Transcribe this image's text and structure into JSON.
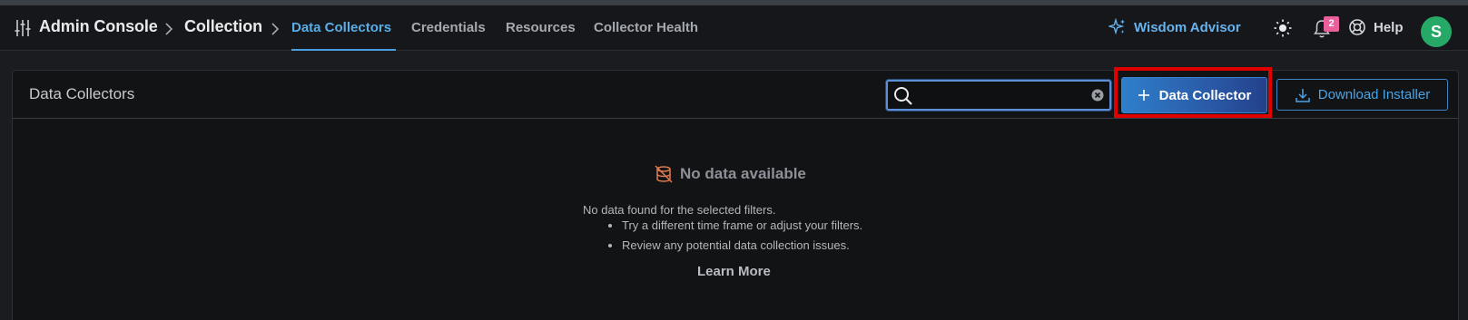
{
  "breadcrumb": {
    "root": "Admin Console",
    "section": "Collection"
  },
  "tabs": [
    {
      "label": "Data Collectors",
      "active": true
    },
    {
      "label": "Credentials",
      "active": false
    },
    {
      "label": "Resources",
      "active": false
    },
    {
      "label": "Collector Health",
      "active": false
    }
  ],
  "header_actions": {
    "wisdom_label": "Wisdom Advisor",
    "notification_count": "2",
    "help_label": "Help",
    "avatar_initial": "S"
  },
  "panel": {
    "title": "Data Collectors",
    "search": {
      "value": "",
      "placeholder": ""
    },
    "add_button_label": "Data Collector",
    "download_button_label": "Download Installer"
  },
  "empty_state": {
    "title": "No data available",
    "message": "No data found for the selected filters.",
    "tips": [
      "Try a different time frame or adjust your filters.",
      "Review any potential data collection issues."
    ],
    "learn_more": "Learn More"
  },
  "colors": {
    "accent": "#5aaee8",
    "primary_button": "#2a5aa8",
    "highlight_box": "#e00000",
    "avatar": "#26a866",
    "badge": "#ea5f9c"
  },
  "icons": [
    "settings-sliders-icon",
    "chevron-right-icon",
    "sparkle-icon",
    "sun-icon",
    "bell-icon",
    "lifebuoy-icon",
    "search-icon",
    "clear-icon",
    "plus-icon",
    "download-icon",
    "no-data-icon"
  ]
}
